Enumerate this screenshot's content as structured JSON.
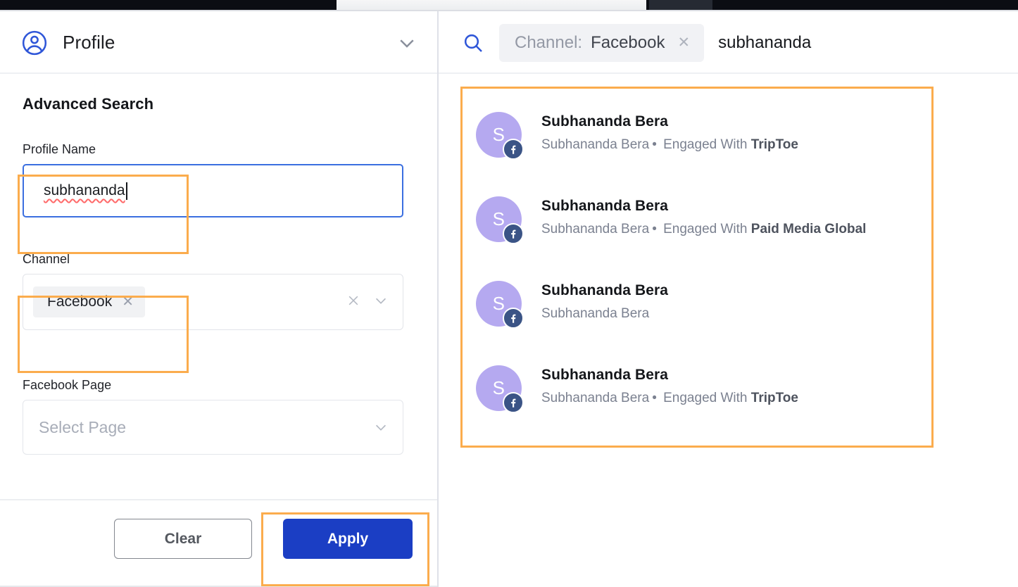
{
  "browser": {
    "tab_strip_label": "browser-tab-strip"
  },
  "left_panel": {
    "header": {
      "title": "Profile",
      "profile_icon": "user-circle-icon",
      "chevron_icon": "chevron-down-icon"
    },
    "section_title": "Advanced Search",
    "fields": {
      "profile_name": {
        "label": "Profile Name",
        "value": "subhananda"
      },
      "channel": {
        "label": "Channel",
        "chips": [
          {
            "label": "Facebook",
            "remove_icon": "close-icon"
          }
        ],
        "clear_icon": "close-icon",
        "dropdown_icon": "chevron-down-icon"
      },
      "facebook_page": {
        "label": "Facebook Page",
        "placeholder": "Select Page",
        "dropdown_icon": "chevron-down-icon"
      }
    },
    "footer": {
      "clear_label": "Clear",
      "apply_label": "Apply"
    }
  },
  "right_panel": {
    "search": {
      "search_icon": "search-icon",
      "token_key": "Channel:",
      "token_value": "Facebook",
      "token_remove_icon": "close-icon",
      "query": "subhananda"
    },
    "results": [
      {
        "avatar_initial": "S",
        "badge": "facebook-icon",
        "name": "Subhananda Bera",
        "sub_name": "Subhananda Bera",
        "separator": "•",
        "engaged_label": "Engaged With",
        "engaged_with": "TripToe"
      },
      {
        "avatar_initial": "S",
        "badge": "facebook-icon",
        "name": "Subhananda Bera",
        "sub_name": "Subhananda Bera",
        "separator": "•",
        "engaged_label": "Engaged With",
        "engaged_with": "Paid Media Global"
      },
      {
        "avatar_initial": "S",
        "badge": "facebook-icon",
        "name": "Subhananda Bera",
        "sub_name": "Subhananda Bera",
        "separator": "",
        "engaged_label": "",
        "engaged_with": ""
      },
      {
        "avatar_initial": "S",
        "badge": "facebook-icon",
        "name": "Subhananda Bera",
        "sub_name": "Subhananda Bera",
        "separator": "•",
        "engaged_label": "Engaged With",
        "engaged_with": "TripToe"
      }
    ]
  },
  "colors": {
    "accent_blue": "#1b3ec4",
    "focus_blue": "#3b6fe0",
    "highlight_orange": "#fbac4d",
    "avatar_purple": "#b5a9f0",
    "facebook_badge": "#3b5486"
  }
}
